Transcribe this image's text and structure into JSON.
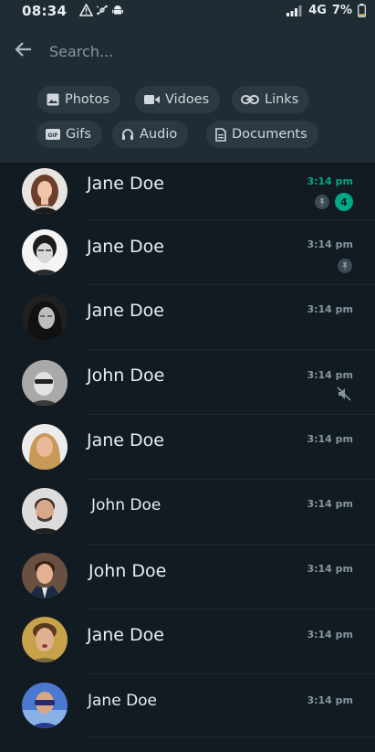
{
  "status_bar": {
    "time": "08:34",
    "network": "4G",
    "battery": "7%"
  },
  "search": {
    "placeholder": "Search..."
  },
  "filters": [
    {
      "label": "Photos",
      "icon": "photo-icon"
    },
    {
      "label": "Vidoes",
      "icon": "video-icon"
    },
    {
      "label": "Links",
      "icon": "link-icon"
    },
    {
      "label": "Gifs",
      "icon": "gif-icon"
    },
    {
      "label": "Audio",
      "icon": "headphones-icon"
    },
    {
      "label": "Documents",
      "icon": "document-icon"
    }
  ],
  "chats": [
    {
      "name": "Jane Doe",
      "time": "3:14 pm",
      "time_highlight": true,
      "pinned": true,
      "unread": "4",
      "muted": false
    },
    {
      "name": "Jane Doe",
      "time": "3:14 pm",
      "time_highlight": false,
      "pinned": true,
      "unread": "",
      "muted": false
    },
    {
      "name": "Jane Doe",
      "time": "3:14 pm",
      "time_highlight": false,
      "pinned": false,
      "unread": "",
      "muted": false
    },
    {
      "name": "John Doe",
      "time": "3:14 pm",
      "time_highlight": false,
      "pinned": false,
      "unread": "",
      "muted": true
    },
    {
      "name": "Jane Doe",
      "time": "3:14 pm",
      "time_highlight": false,
      "pinned": false,
      "unread": "",
      "muted": false
    },
    {
      "name": "John Doe",
      "time": "3:14 pm",
      "time_highlight": false,
      "pinned": false,
      "unread": "",
      "muted": false
    },
    {
      "name": "John Doe",
      "time": "3:14 pm",
      "time_highlight": false,
      "pinned": false,
      "unread": "",
      "muted": false
    },
    {
      "name": "Jane Doe",
      "time": "3:14 pm",
      "time_highlight": false,
      "pinned": false,
      "unread": "",
      "muted": false
    },
    {
      "name": "Jane Doe",
      "time": "3:14 pm",
      "time_highlight": false,
      "pinned": false,
      "unread": "",
      "muted": false
    }
  ],
  "colors": {
    "background": "#111b21",
    "header": "#1f2c33",
    "chip": "#2a3942",
    "accent": "#00a884",
    "secondary_text": "#8696a0"
  }
}
